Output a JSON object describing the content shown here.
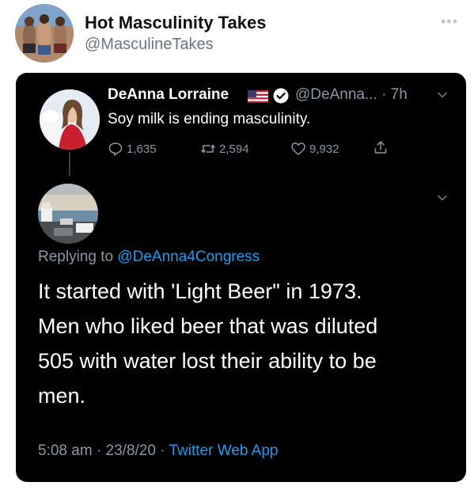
{
  "outer_tweet": {
    "display_name": "Hot Masculinity Takes",
    "handle": "@MasculineTakes",
    "more_label": "•••"
  },
  "quoted_tweet": {
    "display_name": "DeAnna Lorraine",
    "handle": "@DeAnna...",
    "time": "· 7h",
    "text": "Soy milk is ending masculinity.",
    "reply_count": "1,635",
    "retweet_count": "2,594",
    "like_count": "9,932"
  },
  "reply_tweet": {
    "replying_prefix": "Replying to ",
    "replying_mention": "@DeAnna4Congress",
    "text_lines": [
      "It started with 'Light Beer\" in 1973.",
      "Men who liked beer that was diluted",
      "505 with water lost their ability to be",
      "men."
    ],
    "timestamp": "5:08 am · 23/8/20 · ",
    "source": "Twitter Web App"
  },
  "colors": {
    "card_background": "#000000",
    "secondary_text": "#8b98a5",
    "link": "#1d9bf0",
    "primary_text_dark": "#ffffff"
  }
}
